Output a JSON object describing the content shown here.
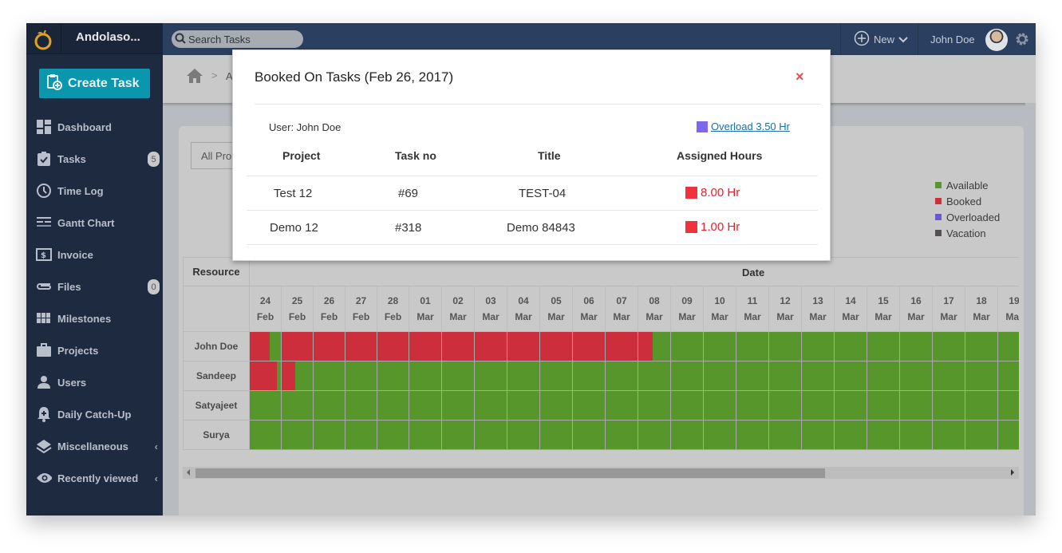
{
  "app": {
    "name": "Andolaso...",
    "logo_icon": "orange-logo-icon"
  },
  "topbar": {
    "search_placeholder": "Search Tasks",
    "new_label": "New",
    "user_name": "John Doe"
  },
  "sidebar": {
    "create_task_label": "Create Task",
    "items": [
      {
        "label": "Dashboard",
        "icon": "dashboard-icon"
      },
      {
        "label": "Tasks",
        "icon": "tasks-icon",
        "badge": "5"
      },
      {
        "label": "Time Log",
        "icon": "clock-icon"
      },
      {
        "label": "Gantt Chart",
        "icon": "gantt-icon"
      },
      {
        "label": "Invoice",
        "icon": "invoice-icon"
      },
      {
        "label": "Files",
        "icon": "paperclip-icon",
        "badge": "0"
      },
      {
        "label": "Milestones",
        "icon": "milestones-icon"
      },
      {
        "label": "Projects",
        "icon": "briefcase-icon"
      },
      {
        "label": "Users",
        "icon": "user-icon"
      },
      {
        "label": "Daily Catch-Up",
        "icon": "bell-plus-icon"
      },
      {
        "label": "Miscellaneous",
        "icon": "layers-icon",
        "chevron": true
      },
      {
        "label": "Recently viewed",
        "icon": "eye-icon",
        "chevron": true
      }
    ]
  },
  "breadcrumb": {
    "partial": "A"
  },
  "filter": {
    "project_select_value": "All Pro"
  },
  "legend": [
    {
      "label": "Available",
      "color": "#57962b"
    },
    {
      "label": "Booked",
      "color": "#cc2e3b"
    },
    {
      "label": "Overloaded",
      "color": "#6a5acd"
    },
    {
      "label": "Vacation",
      "color": "#555155"
    }
  ],
  "gantt": {
    "resource_header": "Resource",
    "date_header": "Date",
    "colors": {
      "available": "#57962b",
      "booked": "#cc2e3b"
    },
    "dates": [
      {
        "day": "24",
        "month": "Feb"
      },
      {
        "day": "25",
        "month": "Feb"
      },
      {
        "day": "26",
        "month": "Feb"
      },
      {
        "day": "27",
        "month": "Feb"
      },
      {
        "day": "28",
        "month": "Feb"
      },
      {
        "day": "01",
        "month": "Mar"
      },
      {
        "day": "02",
        "month": "Mar"
      },
      {
        "day": "03",
        "month": "Mar"
      },
      {
        "day": "04",
        "month": "Mar"
      },
      {
        "day": "05",
        "month": "Mar"
      },
      {
        "day": "06",
        "month": "Mar"
      },
      {
        "day": "07",
        "month": "Mar"
      },
      {
        "day": "08",
        "month": "Mar"
      },
      {
        "day": "09",
        "month": "Mar"
      },
      {
        "day": "10",
        "month": "Mar"
      },
      {
        "day": "11",
        "month": "Mar"
      },
      {
        "day": "12",
        "month": "Mar"
      },
      {
        "day": "13",
        "month": "Mar"
      },
      {
        "day": "14",
        "month": "Mar"
      },
      {
        "day": "15",
        "month": "Mar"
      },
      {
        "day": "16",
        "month": "Mar"
      },
      {
        "day": "17",
        "month": "Mar"
      },
      {
        "day": "18",
        "month": "Mar"
      },
      {
        "day": "19",
        "month": "Mar"
      }
    ],
    "resources": [
      {
        "name": "John Doe",
        "booked_fraction": [
          0.65,
          1,
          1,
          1,
          1,
          1,
          1,
          1,
          1,
          1,
          1,
          1,
          0.45,
          0,
          0,
          0,
          0,
          0,
          0,
          0,
          0,
          0,
          0,
          0
        ]
      },
      {
        "name": "Sandeep",
        "booked_fraction": [
          0.88,
          0.43,
          0,
          0,
          0,
          0,
          0,
          0,
          0,
          0,
          0,
          0,
          0,
          0,
          0,
          0,
          0,
          0,
          0,
          0,
          0,
          0,
          0,
          0
        ]
      },
      {
        "name": "Satyajeet",
        "booked_fraction": [
          0,
          0,
          0,
          0,
          0,
          0,
          0,
          0,
          0,
          0,
          0,
          0,
          0,
          0,
          0,
          0,
          0,
          0,
          0,
          0,
          0,
          0,
          0,
          0
        ]
      },
      {
        "name": "Surya",
        "booked_fraction": [
          0,
          0,
          0,
          0,
          0,
          0,
          0,
          0,
          0,
          0,
          0,
          0,
          0,
          0,
          0,
          0,
          0,
          0,
          0,
          0,
          0,
          0,
          0,
          0
        ]
      }
    ],
    "scroll_position_fraction": 0.0
  },
  "modal": {
    "title": "Booked On Tasks (Feb 26, 2017)",
    "close_label": "×",
    "user_label": "User: John Doe",
    "overload_label": "Overload 3.50 Hr",
    "overload_color": "#7b68ee",
    "columns": [
      "Project",
      "Task no",
      "Title",
      "Assigned Hours"
    ],
    "rows": [
      {
        "project": "Test 12",
        "task_no": "#69",
        "title": "TEST-04",
        "hours": "8.00 Hr"
      },
      {
        "project": "Demo 12",
        "task_no": "#318",
        "title": "Demo 84843",
        "hours": "1.00 Hr"
      }
    ]
  }
}
